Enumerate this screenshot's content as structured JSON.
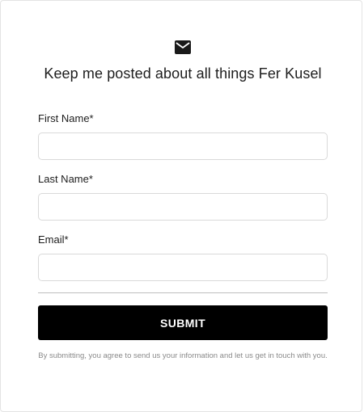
{
  "form": {
    "heading": "Keep me posted about all things Fer Kusel",
    "icon": "envelope-icon",
    "fields": [
      {
        "label": "First Name*",
        "value": "",
        "placeholder": ""
      },
      {
        "label": "Last Name*",
        "value": "",
        "placeholder": ""
      },
      {
        "label": "Email*",
        "value": "",
        "placeholder": ""
      }
    ],
    "submit_label": "SUBMIT",
    "disclaimer": "By submitting, you agree to send us your information and let us get in touch with you."
  },
  "colors": {
    "button_bg": "#000000",
    "button_text": "#ffffff",
    "input_border": "#d9d9d9",
    "disclaimer_text": "#8a8a8a"
  }
}
